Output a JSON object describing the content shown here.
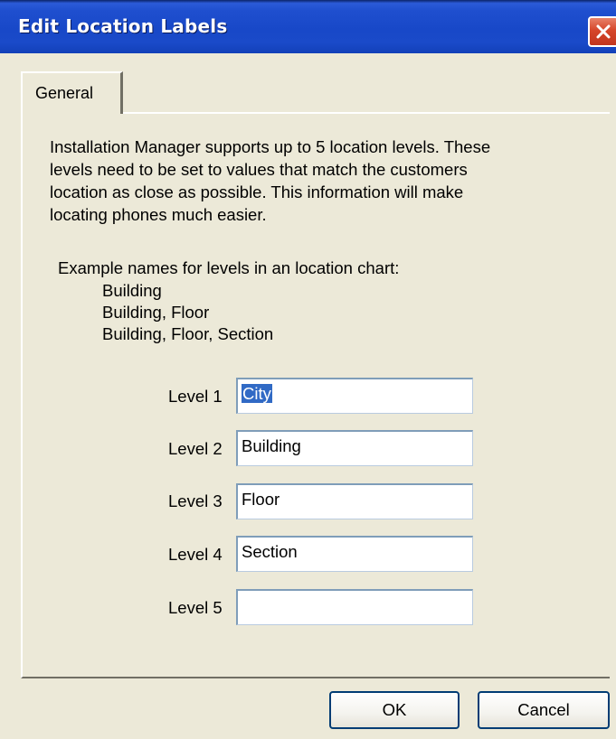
{
  "window": {
    "title": "Edit Location Labels"
  },
  "icons": {
    "close": "close-icon"
  },
  "colors": {
    "titlebar": "#1848c8",
    "close_button": "#d6462a",
    "dialog_background": "#ece9d8",
    "selection": "#316ac5"
  },
  "tabs": [
    {
      "label": "General",
      "selected": true
    }
  ],
  "general": {
    "description_lines": [
      "Installation Manager supports up to 5 location levels. These",
      "levels need to be set to values that match the customers",
      "location as close as possible. This information will make",
      "locating phones much easier."
    ],
    "example_heading": "Example names for levels in an location chart:",
    "examples": [
      "Building",
      "Building, Floor",
      "Building, Floor, Section"
    ],
    "levels": [
      {
        "label": "Level 1",
        "value": "City",
        "selected_text": true
      },
      {
        "label": "Level 2",
        "value": "Building"
      },
      {
        "label": "Level 3",
        "value": "Floor"
      },
      {
        "label": "Level 4",
        "value": "Section"
      },
      {
        "label": "Level 5",
        "value": ""
      }
    ]
  },
  "buttons": {
    "ok": "OK",
    "cancel": "Cancel"
  }
}
